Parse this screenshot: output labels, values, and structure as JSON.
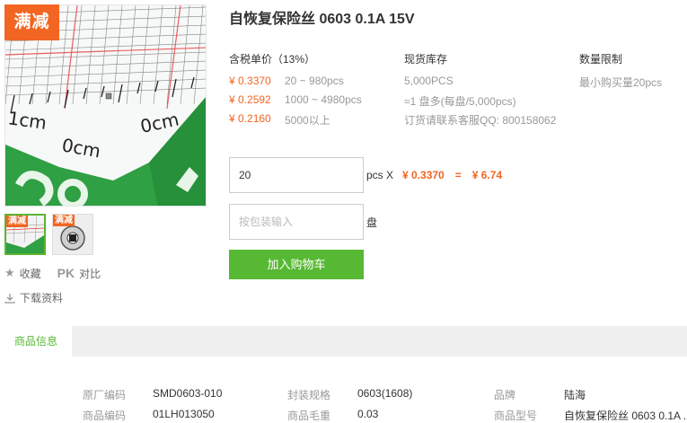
{
  "image": {
    "promo_tag": "满减",
    "ruler_label_1": "1cm",
    "ruler_label_2": "0cm",
    "ruler_label_3": "0cm"
  },
  "thumbnails": [
    {
      "tag": "满减"
    },
    {
      "tag": "满减"
    }
  ],
  "actions": {
    "favorite": "收藏",
    "compare_prefix": "PK",
    "compare": "对比",
    "download": "下载资料"
  },
  "product": {
    "title": "自恢复保险丝 0603 0.1A 15V"
  },
  "pricing": {
    "header": "含税单价（13%）",
    "tiers": [
      {
        "price": "¥ 0.3370",
        "range": "20 ~ 980pcs"
      },
      {
        "price": "¥ 0.2592",
        "range": "1000 ~ 4980pcs"
      },
      {
        "price": "¥ 0.2160",
        "range": "5000以上"
      }
    ]
  },
  "stock": {
    "header": "现货库存",
    "lines": [
      "5,000PCS",
      "≈1 盘多(每盘/5,000pcs)",
      "订货请联系客服QQ: 800158062"
    ]
  },
  "limit": {
    "header": "数量限制",
    "text": "最小购买量20pcs"
  },
  "order": {
    "qty_value": "20",
    "pcs_x": "pcs X",
    "unit_price": "¥ 0.3370",
    "equals": "=",
    "total": "¥ 6.74",
    "pack_placeholder": "按包装输入",
    "pan": "盘",
    "add_to_cart": "加入购物车"
  },
  "tabs": {
    "info": "商品信息"
  },
  "specs": {
    "row1": [
      {
        "label": "原厂编码",
        "value": "SMD0603-010"
      },
      {
        "label": "封装规格",
        "value": "0603(1608)"
      },
      {
        "label": "品牌",
        "value": "陆海"
      }
    ],
    "row2": [
      {
        "label": "商品编码",
        "value": "01LH013050"
      },
      {
        "label": "商品毛重",
        "value": "0.03"
      },
      {
        "label": "商品型号",
        "value": "自恢复保险丝 0603 0.1A ..."
      }
    ]
  },
  "colors": {
    "accent_orange": "#f26522",
    "accent_green": "#57b833"
  }
}
